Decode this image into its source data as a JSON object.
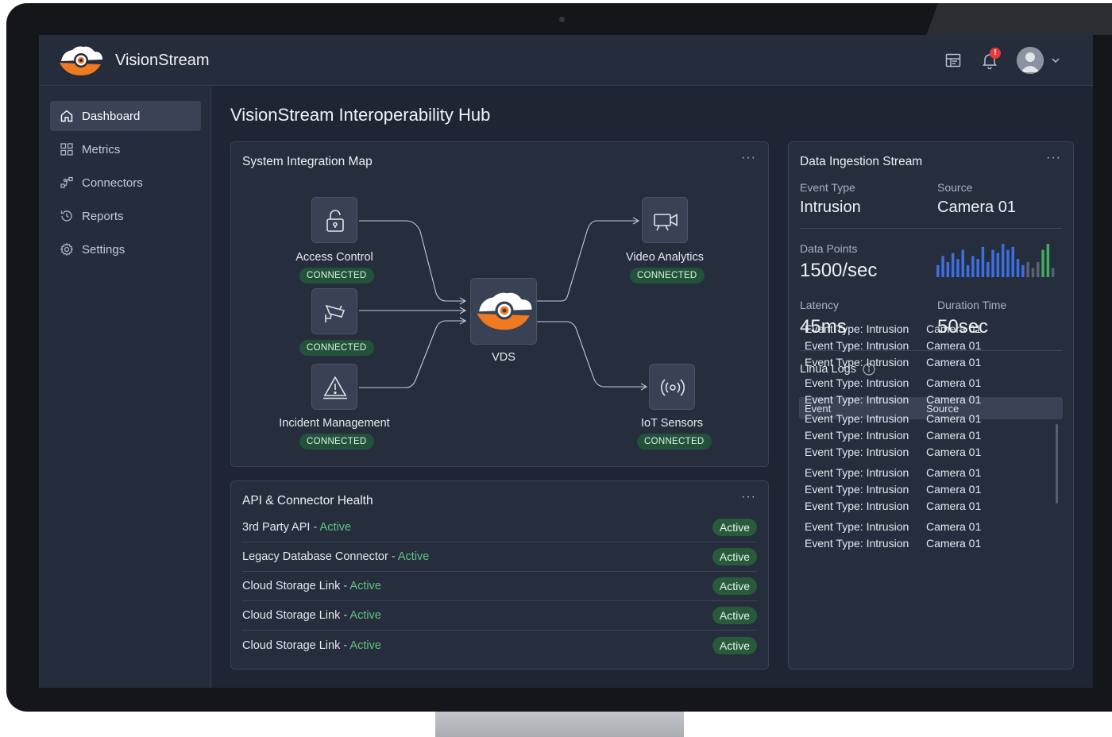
{
  "app": {
    "name": "VisionStream"
  },
  "topbar": {
    "notification_count": "!"
  },
  "sidebar": {
    "items": [
      {
        "label": "Dashboard",
        "icon": "home-icon",
        "active": true
      },
      {
        "label": "Metrics",
        "icon": "grid-icon",
        "active": false
      },
      {
        "label": "Connectors",
        "icon": "connectors-icon",
        "active": false
      },
      {
        "label": "Reports",
        "icon": "history-icon",
        "active": false
      },
      {
        "label": "Settings",
        "icon": "gear-icon",
        "active": false
      }
    ]
  },
  "page": {
    "title": "VisionStream Interoperability Hub"
  },
  "integration_map": {
    "title": "System Integration Map",
    "hub_label": "VDS",
    "nodes": [
      {
        "label": "Access Control",
        "status": "CONNECTED",
        "icon": "lock-icon"
      },
      {
        "label": "",
        "status": "CONNECTED",
        "icon": "security-camera-icon"
      },
      {
        "label": "Incident Management",
        "status": "CONNECTED",
        "icon": "warning-icon"
      },
      {
        "label": "Video Analytics",
        "status": "CONNECTED",
        "icon": "video-camera-icon"
      },
      {
        "label": "IoT Sensors",
        "status": "CONNECTED",
        "icon": "sensor-icon"
      }
    ]
  },
  "api_health": {
    "title": "API & Connector Health",
    "rows": [
      {
        "name": "3rd Party API",
        "status": "Active",
        "badge": "Active"
      },
      {
        "name": "Legacy Database Connector",
        "status": "Active",
        "badge": "Active"
      },
      {
        "name": "Cloud Storage Link",
        "status": "Active",
        "badge": "Active"
      },
      {
        "name": "Cloud Storage Link",
        "status": "Active",
        "badge": "Active"
      },
      {
        "name": "Cloud Storage Link",
        "status": "Active",
        "badge": "Active"
      }
    ],
    "separator": " - "
  },
  "ingestion": {
    "title": "Data Ingestion Stream",
    "event_type_label": "Event Type",
    "event_type_value": "Intrusion",
    "source_label": "Source",
    "source_value": "Camera 01",
    "data_points_label": "Data Points",
    "data_points_value": "1500/sec",
    "latency_label": "Latency",
    "latency_value": "45ms",
    "duration_label": "Duration Time",
    "duration_value": "50sec",
    "logs_label": "Linua Logs",
    "log_columns": {
      "event": "Event",
      "source": "Source"
    },
    "logs": [
      {
        "event": "Event Type: Intrusion",
        "source": "Camera 01"
      },
      {
        "event": "Event Type: Intrusion",
        "source": "Camera 01"
      },
      {
        "event": "Event Type: Intrusion",
        "source": "Camera 01"
      },
      {
        "event": "Event Type: Intrusion",
        "source": "Camera 01"
      },
      {
        "event": "Event Type: Intrusion",
        "source": "Camera 01"
      },
      {
        "event": "Event Type: Intrusion",
        "source": "Camera 01"
      },
      {
        "event": "Event Type: Intrusion",
        "source": "Camera 01"
      },
      {
        "event": "Event Type: Intrusion",
        "source": "Camera 01"
      },
      {
        "event": "Event Type: Intrusion",
        "source": "Camera 01"
      },
      {
        "event": "Event Type: Intrusion",
        "source": "Camera 01"
      },
      {
        "event": "Event Type: Intrusion",
        "source": "Camera 01"
      },
      {
        "event": "Event Type: Intrusion",
        "source": "Camera 01"
      },
      {
        "event": "Event Type: Intrusion",
        "source": "Camera 01"
      }
    ],
    "sparkline": {
      "values": [
        4,
        7,
        5,
        8,
        6,
        9,
        4,
        7,
        6,
        10,
        5,
        9,
        8,
        11,
        9,
        10,
        6,
        4,
        5,
        3,
        5,
        9,
        11,
        3
      ],
      "colors": [
        "blue",
        "blue",
        "blue",
        "blue",
        "blue",
        "blue",
        "blue",
        "blue",
        "blue",
        "blue",
        "blue",
        "blue",
        "blue",
        "blue",
        "blue",
        "blue",
        "blue",
        "blue",
        "gray",
        "gray",
        "gray",
        "green",
        "green",
        "gray"
      ]
    }
  },
  "colors": {
    "accent_orange": "#f07a22",
    "success_green": "#5fc482",
    "badge_green_bg": "#2a5a3c",
    "spark_blue": "#3d6fe0",
    "spark_green": "#3fae5e",
    "spark_gray": "#5b6272",
    "notification_red": "#e53a3a"
  }
}
